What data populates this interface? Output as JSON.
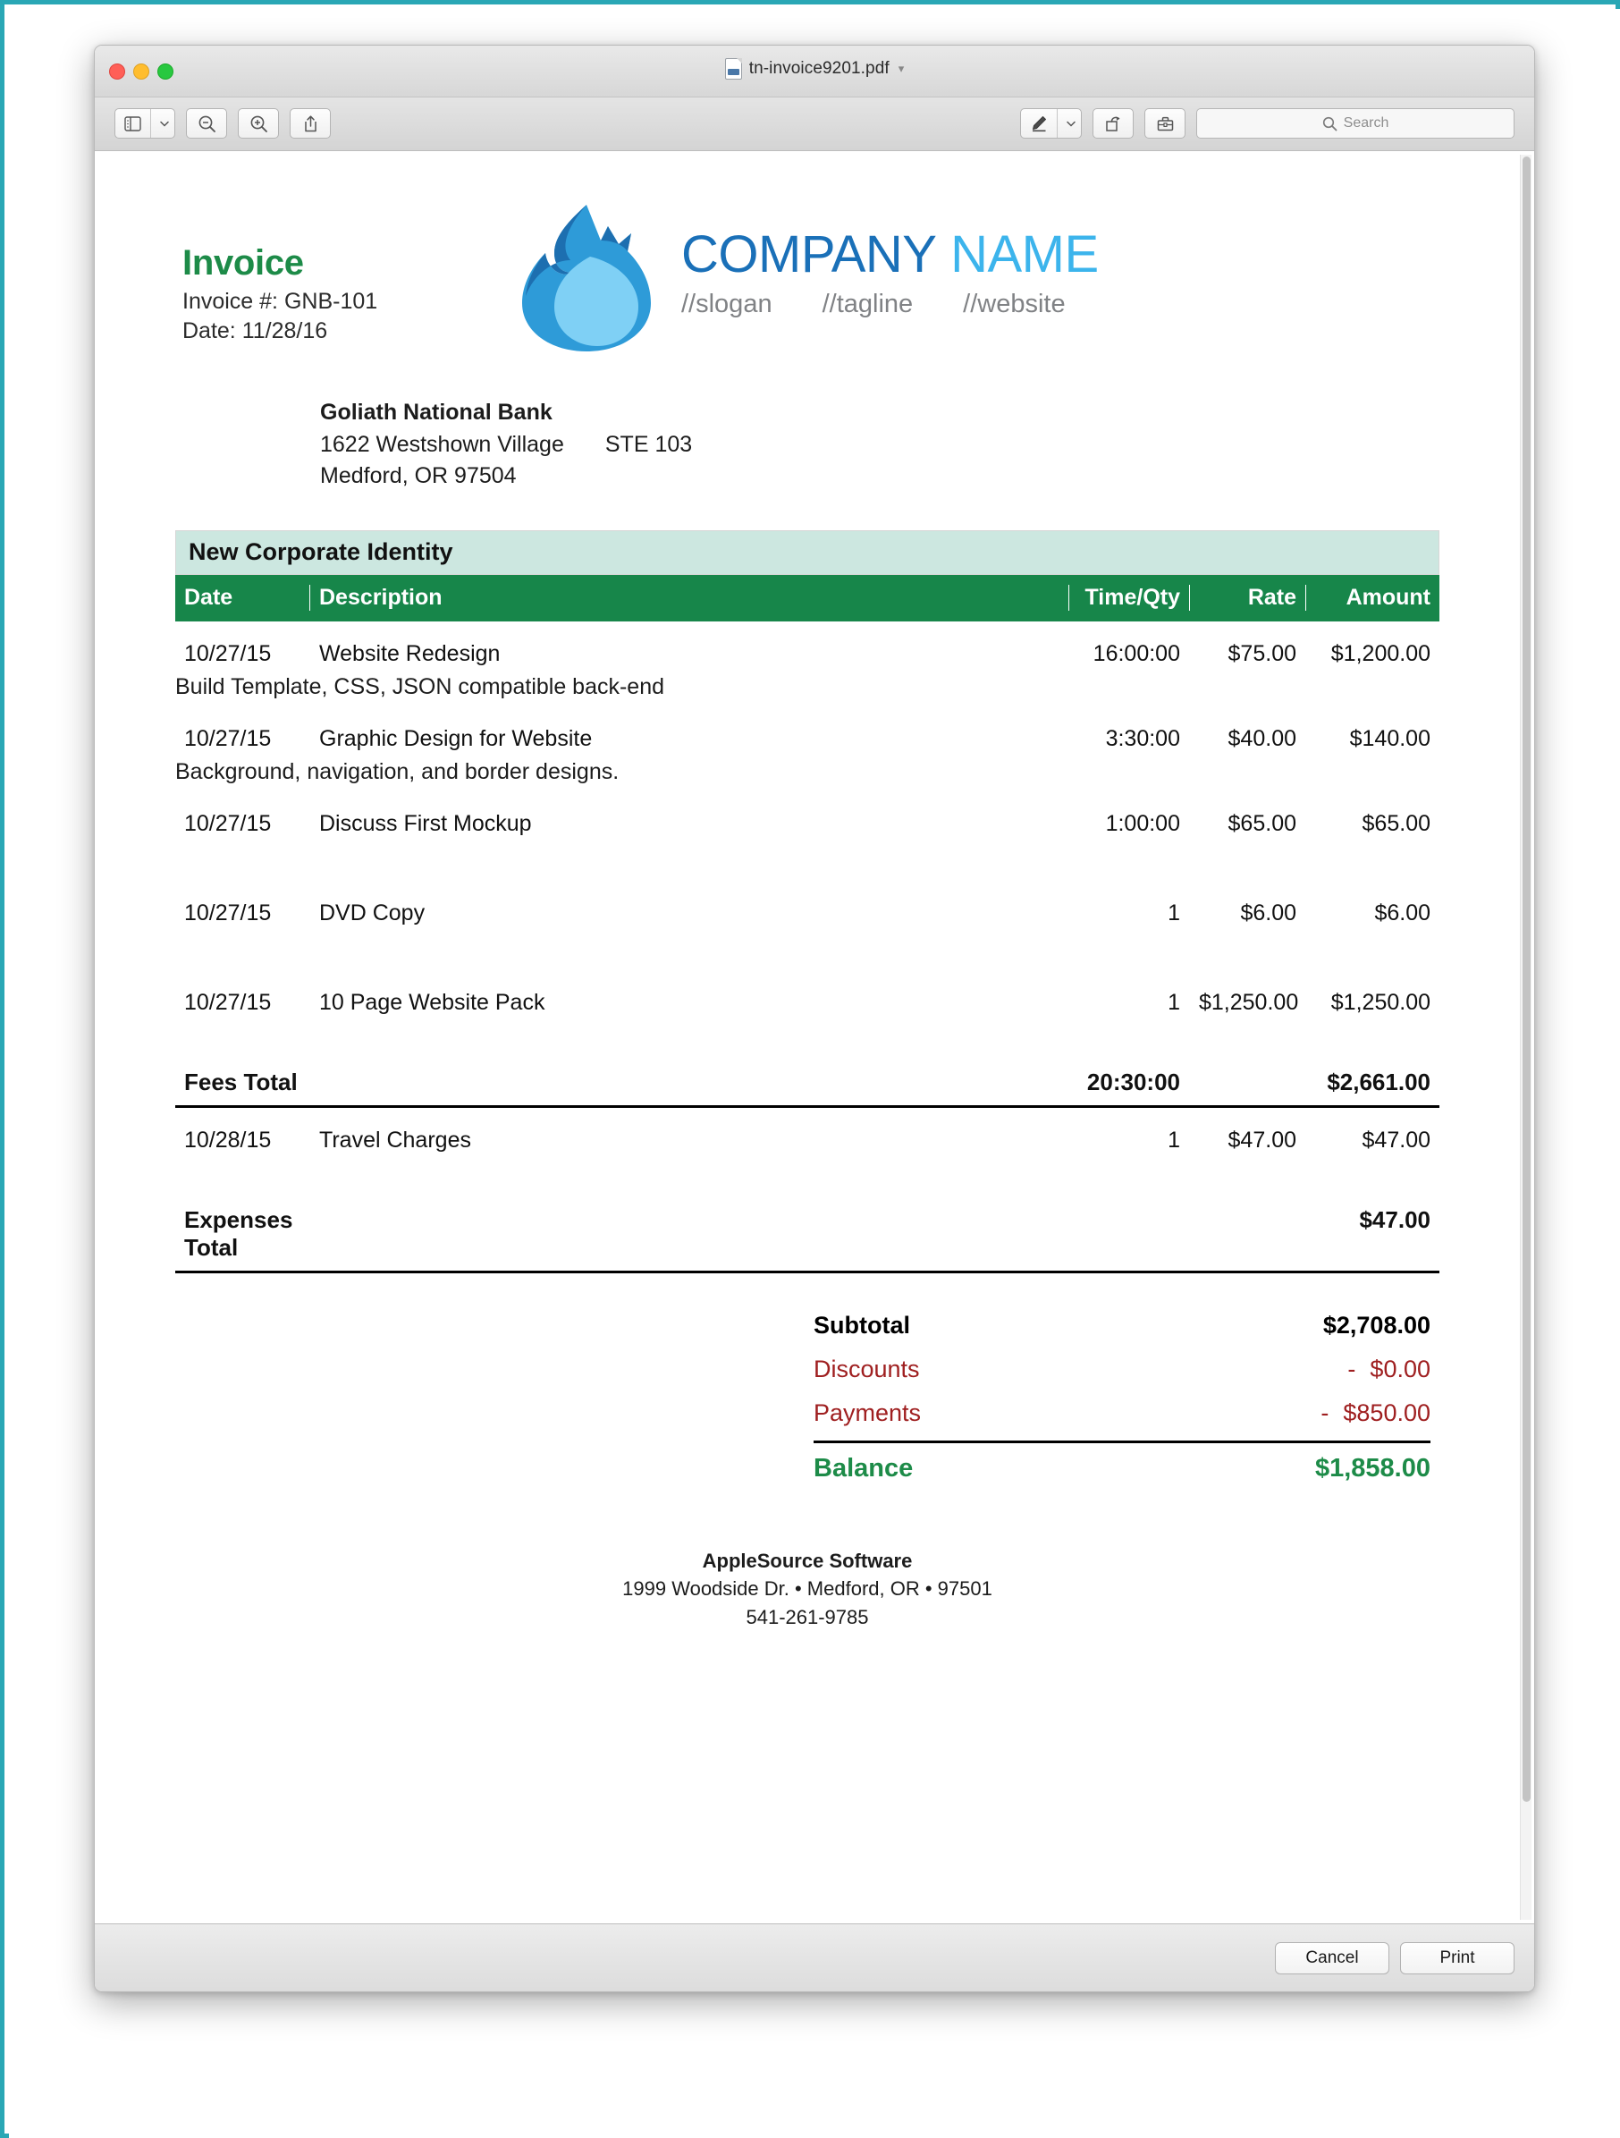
{
  "window": {
    "title": "tn-invoice9201.pdf",
    "title_chevron": "chevron-down-icon"
  },
  "toolbar": {
    "sidebar_button": "sidebar-icon",
    "zoom_out_button": "zoom-out-icon",
    "zoom_in_button": "zoom-in-icon",
    "share_button": "share-icon",
    "markup_button": "markup-pen-icon",
    "markup_dropdown": "chevron-down-icon",
    "rotate_button": "rotate-icon",
    "toolbox_button": "toolbox-icon",
    "search_placeholder": "Search",
    "search_value": ""
  },
  "bottombar": {
    "cancel_label": "Cancel",
    "print_label": "Print"
  },
  "invoice": {
    "title": "Invoice",
    "number_line": "Invoice #: GNB-101",
    "date_line": "Date: 11/28/16",
    "brand": {
      "name_part1": "COMPANY",
      "name_part2": "NAME",
      "slogan": "//slogan",
      "tagline": "//tagline",
      "website": "//website"
    },
    "bill_to": {
      "name": "Goliath National Bank",
      "street": "1622 Westshown Village",
      "suite": "STE 103",
      "city_state_zip": "Medford, OR 97504"
    },
    "project_title": "New Corporate Identity",
    "columns": {
      "date": "Date",
      "description": "Description",
      "time_qty": "Time/Qty",
      "rate": "Rate",
      "amount": "Amount"
    },
    "fee_items": [
      {
        "date": "10/27/15",
        "description": "Website Redesign",
        "subdescription": "Build Template, CSS, JSON compatible back-end",
        "time_qty": "16:00:00",
        "rate": "$75.00",
        "amount": "$1,200.00"
      },
      {
        "date": "10/27/15",
        "description": "Graphic Design for Website",
        "subdescription": "Background, navigation, and border designs.",
        "time_qty": "3:30:00",
        "rate": "$40.00",
        "amount": "$140.00"
      },
      {
        "date": "10/27/15",
        "description": "Discuss First Mockup",
        "subdescription": "",
        "time_qty": "1:00:00",
        "rate": "$65.00",
        "amount": "$65.00"
      },
      {
        "date": "10/27/15",
        "description": "DVD Copy",
        "subdescription": "",
        "time_qty": "1",
        "rate": "$6.00",
        "amount": "$6.00"
      },
      {
        "date": "10/27/15",
        "description": "10 Page Website Pack",
        "subdescription": "",
        "time_qty": "1",
        "rate": "$1,250.00",
        "amount": "$1,250.00"
      }
    ],
    "fees_total": {
      "label": "Fees Total",
      "time_qty": "20:30:00",
      "amount": "$2,661.00"
    },
    "expense_items": [
      {
        "date": "10/28/15",
        "description": "Travel Charges",
        "subdescription": "",
        "time_qty": "1",
        "rate": "$47.00",
        "amount": "$47.00"
      }
    ],
    "expenses_total": {
      "label": "Expenses Total",
      "time_qty": "",
      "amount": "$47.00"
    },
    "summary": {
      "subtotal_label": "Subtotal",
      "subtotal_value": "$2,708.00",
      "discounts_label": "Discounts",
      "discounts_sign": "-",
      "discounts_value": "$0.00",
      "payments_label": "Payments",
      "payments_sign": "-",
      "payments_value": "$850.00",
      "balance_label": "Balance",
      "balance_value": "$1,858.00"
    },
    "footer": {
      "company": "AppleSource Software",
      "address": "1999 Woodside Dr.  • Medford, OR • 97501",
      "phone": "541-261-9785"
    }
  },
  "colors": {
    "invoice_green": "#1d8b48",
    "table_header_green": "#17864a",
    "project_band": "#cce7e0",
    "brand_dark_blue": "#1a70b8",
    "brand_light_blue": "#3cb4ec",
    "negative_red": "#9f1f20",
    "frame_teal": "#2aa7b5"
  }
}
